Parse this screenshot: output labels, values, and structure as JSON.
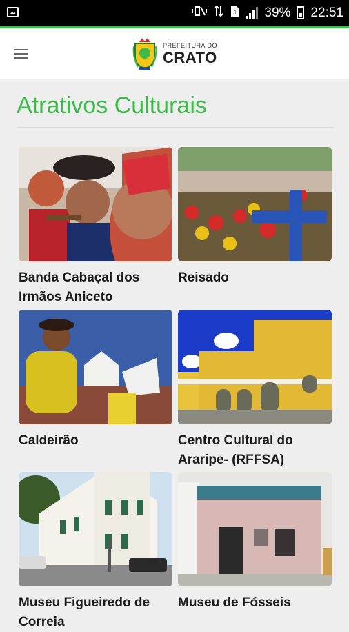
{
  "status_bar": {
    "battery": "39%",
    "time": "22:51"
  },
  "header": {
    "menu_icon": "hamburger-menu-icon",
    "logo_top": "PREFEITURA DO",
    "logo_main": "CRATO"
  },
  "page": {
    "title": "Atrativos Culturais"
  },
  "items": [
    {
      "label": "Banda Cabaçal dos Irmãos Aniceto"
    },
    {
      "label": "Reisado"
    },
    {
      "label": "Caldeirão"
    },
    {
      "label": "Centro Cultural do Araripe- (RFFSA)"
    },
    {
      "label": "Museu Figueiredo de Correia"
    },
    {
      "label": "Museu de Fósseis"
    }
  ],
  "colors": {
    "accent": "#3dba4a"
  }
}
